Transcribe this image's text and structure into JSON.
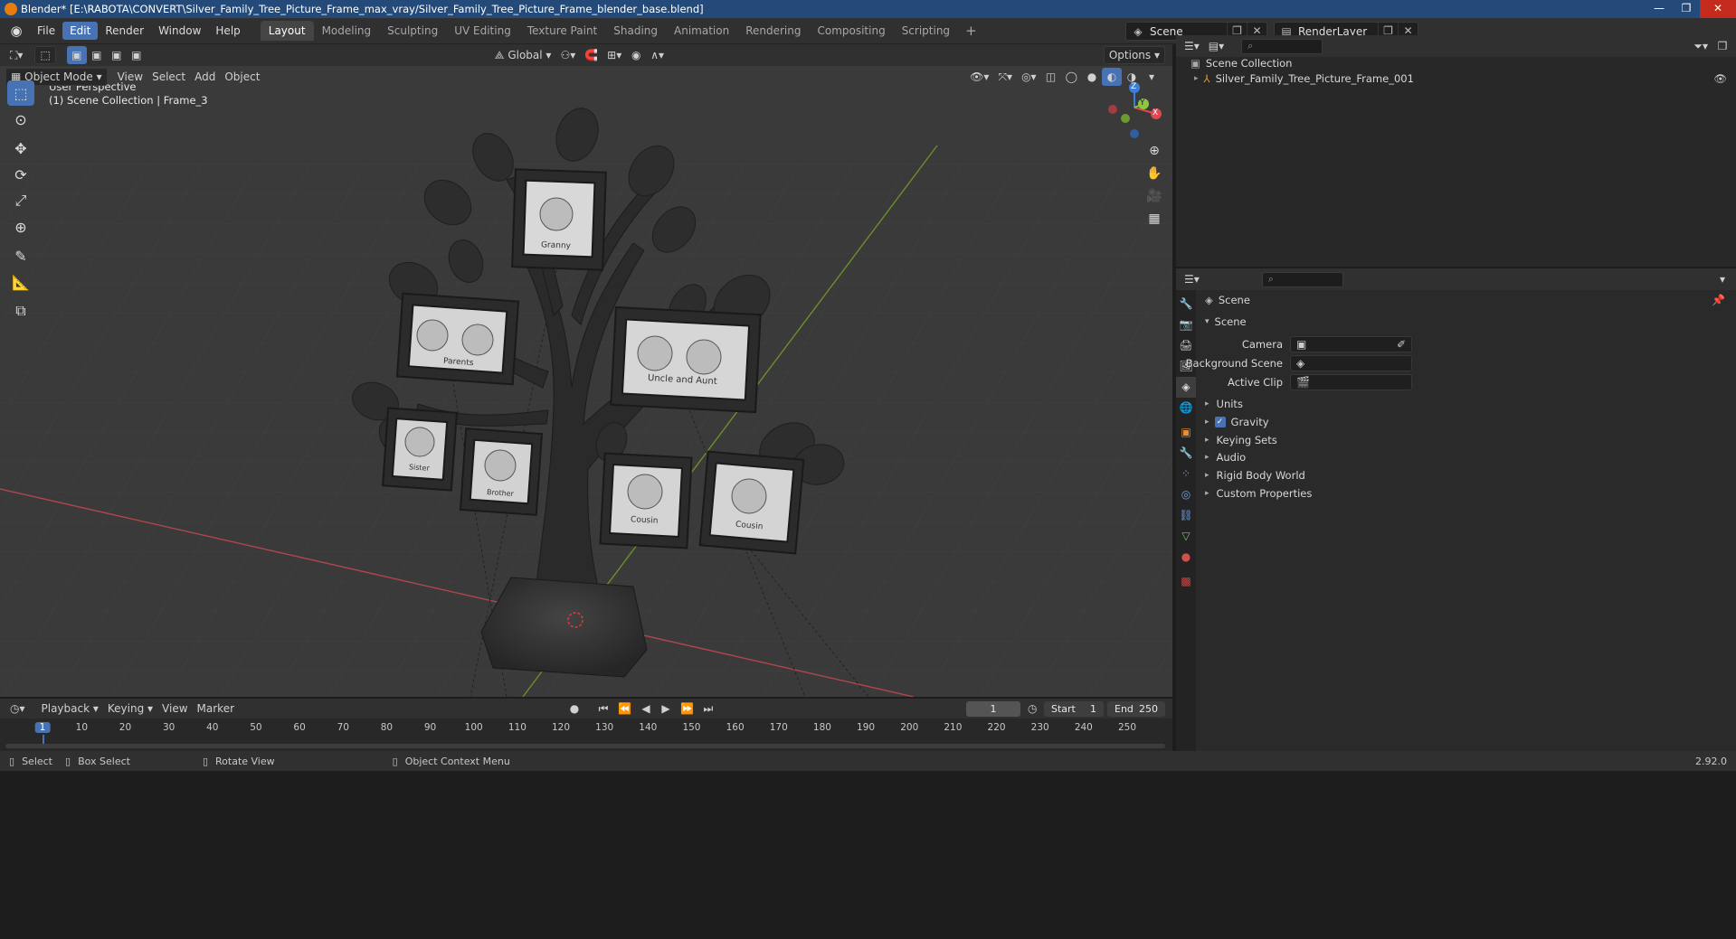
{
  "window": {
    "title": "Blender* [E:\\RABOTA\\CONVERT\\Silver_Family_Tree_Picture_Frame_max_vray/Silver_Family_Tree_Picture_Frame_blender_base.blend]",
    "minimize": "—",
    "maximize": "❐",
    "close": "✕"
  },
  "menu": [
    "File",
    "Edit",
    "Render",
    "Window",
    "Help"
  ],
  "active_menu": "Edit",
  "workspaces": [
    "Layout",
    "Modeling",
    "Sculpting",
    "UV Editing",
    "Texture Paint",
    "Shading",
    "Animation",
    "Rendering",
    "Compositing",
    "Scripting"
  ],
  "scene_field": "Scene",
  "render_layer_field": "RenderLayer",
  "viewport_header": {
    "transform_orientation": "Global",
    "options": "Options"
  },
  "viewport_menu": {
    "mode": "Object Mode",
    "items": [
      "View",
      "Select",
      "Add",
      "Object"
    ]
  },
  "viewport_info": {
    "perspective": "User Perspective",
    "collection": "(1) Scene Collection | Frame_3"
  },
  "axes": {
    "x": "X",
    "y": "Y",
    "z": "Z"
  },
  "frame_labels": [
    "Granny",
    "Parents",
    "Uncle and Aunt",
    "Sister",
    "Brother",
    "Cousin",
    "Cousin"
  ],
  "outliner": {
    "root": "Scene Collection",
    "items": [
      "Silver_Family_Tree_Picture_Frame_001"
    ]
  },
  "properties": {
    "context": "Scene",
    "panel": "Scene",
    "camera_label": "Camera",
    "background_scene_label": "Background Scene",
    "active_clip_label": "Active Clip",
    "sections": [
      "Units",
      "Gravity",
      "Keying Sets",
      "Audio",
      "Rigid Body World",
      "Custom Properties"
    ],
    "gravity_checked": true
  },
  "timeline": {
    "menus": [
      "Playback",
      "Keying",
      "View",
      "Marker"
    ],
    "current_frame": "1",
    "start_label": "Start",
    "start": "1",
    "end_label": "End",
    "end": "250",
    "ruler": [
      "1",
      "10",
      "20",
      "30",
      "40",
      "50",
      "60",
      "70",
      "80",
      "90",
      "100",
      "110",
      "120",
      "130",
      "140",
      "150",
      "160",
      "170",
      "180",
      "190",
      "200",
      "210",
      "220",
      "230",
      "240",
      "250"
    ]
  },
  "statusbar": {
    "select": "Select",
    "box_select": "Box Select",
    "rotate_view": "Rotate View",
    "context_menu": "Object Context Menu",
    "version": "2.92.0"
  },
  "colors": {
    "accent": "#4772b3",
    "x_axis": "#e0474e",
    "y_axis": "#8dc73f",
    "z_axis": "#3d7fd6",
    "titlebar": "#244a7a"
  }
}
